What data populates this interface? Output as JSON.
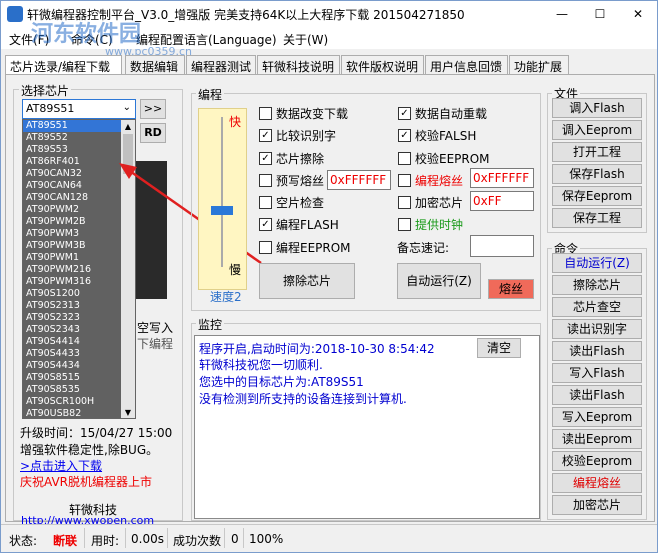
{
  "window": {
    "title": "轩微编程器控制平台_V3.0_增强版 完美支持64K以上大程序下载 201504271850",
    "minimize": "—",
    "maximize": "☐",
    "close": "✕",
    "watermark": "河东软件园",
    "watermark_url": "www.pc0359.cn"
  },
  "menu": [
    "文件(F)",
    "命令(C)",
    "编程配置语言(Language)",
    "关于(W)"
  ],
  "tabs": [
    "芯片选录/编程下载",
    "数据编辑",
    "编程器测试",
    "轩微科技说明",
    "软件版权说明",
    "用户信息回馈",
    "功能扩展"
  ],
  "chip_select": {
    "label": "选择芯片",
    "selected": "AT89S51",
    "arrow_button": ">>",
    "rd_button": "RD",
    "options": [
      "AT89S51",
      "AT89S52",
      "AT89S53",
      "AT86RF401",
      "AT90CAN32",
      "AT90CAN64",
      "AT90CAN128",
      "AT90PWM2",
      "AT90PWM2B",
      "AT90PWM3",
      "AT90PWM3B",
      "AT90PWM1",
      "AT90PWM216",
      "AT90PWM316",
      "AT90S1200",
      "AT90S2313",
      "AT90S2323",
      "AT90S2343",
      "AT90S4414",
      "AT90S4433",
      "AT90S4434",
      "AT90S8515",
      "AT90S8535",
      "AT90SCR100H",
      "AT90USB82"
    ]
  },
  "left_info": {
    "partial_1": "空写入",
    "partial_2": "下编程",
    "update_time": "升级时间：15/04/27 15:00",
    "improve": "增强软件稳定性,除BUG。",
    "download_link": ">点击进入下载",
    "celebrate": "庆祝AVR脱机编程器上市",
    "company": "轩微科技",
    "website": "http://www.xwopen.com"
  },
  "program": {
    "label": "编程",
    "fast": "快",
    "slow": "慢",
    "speed": "速度2",
    "speed_level": 2,
    "checks": [
      {
        "label": "数据改变下载",
        "checked": false
      },
      {
        "label": "比较识别字",
        "checked": true
      },
      {
        "label": "芯片擦除",
        "checked": true
      },
      {
        "label": "预写熔丝",
        "checked": false
      },
      {
        "label": "空片检查",
        "checked": false
      },
      {
        "label": "编程FLASH",
        "checked": true
      },
      {
        "label": "编程EEPROM",
        "checked": false
      }
    ],
    "checks_right": [
      {
        "label": "数据自动重载",
        "checked": true
      },
      {
        "label": "校验FALSH",
        "checked": true
      },
      {
        "label": "校验EEPROM",
        "checked": false
      },
      {
        "label": "编程熔丝",
        "checked": false
      },
      {
        "label": "加密芯片",
        "checked": false
      },
      {
        "label": "提供时钟",
        "checked": false
      }
    ],
    "prewrite_value": "0xFFFFFF",
    "fuse_value": "0xFFFFFF",
    "encrypt_value": "0xFF",
    "memo_label": "备忘速记:",
    "memo_value": "",
    "erase_button": "擦除芯片",
    "auto_run_button": "自动运行(Z)",
    "fuse_button": "熔丝"
  },
  "monitor": {
    "label": "监控",
    "clear_button": "清空",
    "lines": [
      "程序开启,启动时间为:2018-10-30 8:54:42",
      "轩微科技祝您一切顺利.",
      "您选中的目标芯片为:AT89S51",
      "没有检测到所支持的设备连接到计算机."
    ]
  },
  "file_panel": {
    "label": "文件",
    "buttons": [
      "调入Flash",
      "调入Eeprom",
      "打开工程",
      "保存Flash",
      "保存Eeprom",
      "保存工程"
    ]
  },
  "command_panel": {
    "label": "命令",
    "buttons": [
      "自动运行(Z)",
      "擦除芯片",
      "芯片查空",
      "读出识别字",
      "读出Flash",
      "写入Flash",
      "读出Flash",
      "写入Eeprom",
      "读出Eeprom",
      "校验Eeprom",
      "编程熔丝",
      "加密芯片"
    ]
  },
  "status": {
    "state_label": "状态:",
    "state_value": "断联",
    "time_label": "用时:",
    "time_value": "0.00s",
    "success_label": "成功次数",
    "success_value": "0",
    "progress": "100%"
  },
  "colors": {
    "accent_red": "#e00000",
    "link_blue": "#0000ee",
    "selection_blue": "#3375d6"
  }
}
